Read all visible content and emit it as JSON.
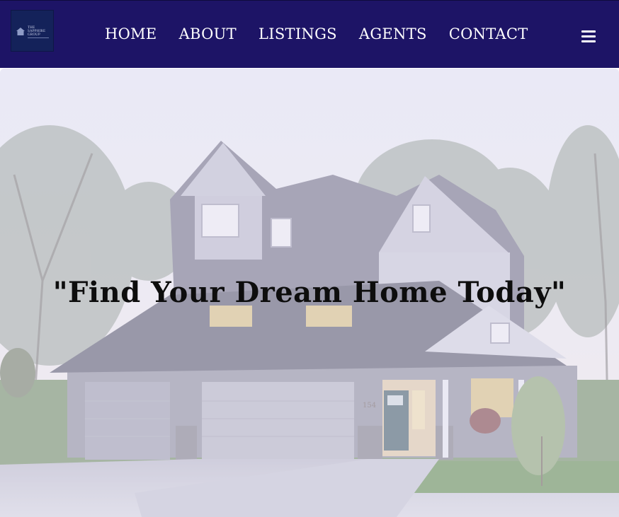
{
  "brand": {
    "logo_line1": "THE",
    "logo_line2": "SAPPHIRE",
    "logo_line3": "GROUP",
    "logo_icon": "house-icon"
  },
  "nav": {
    "items": [
      {
        "label": "HOME"
      },
      {
        "label": "ABOUT"
      },
      {
        "label": "LISTINGS"
      },
      {
        "label": "AGENTS"
      },
      {
        "label": "CONTACT"
      }
    ],
    "menu_icon": "hamburger-menu-icon"
  },
  "hero": {
    "heading": "\"Find Your Dream Home Today\"",
    "house_number": "154",
    "background_image": "house-exterior-photo"
  },
  "colors": {
    "navbar": "#1d1466",
    "logo_bg": "#14225a",
    "nav_text": "#ffffff",
    "heading_text": "#0d0d0d"
  }
}
